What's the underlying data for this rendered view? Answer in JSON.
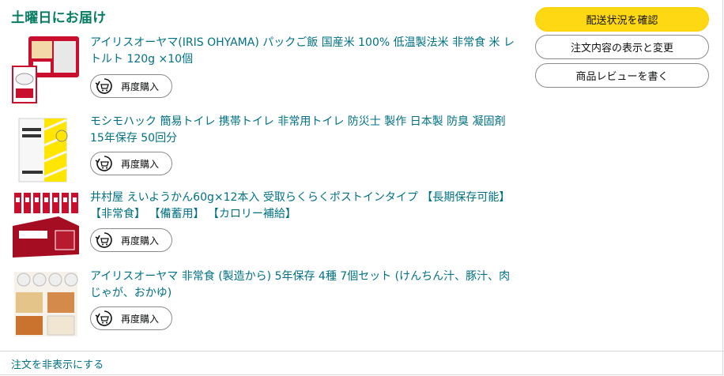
{
  "delivery": {
    "heading": "土曜日にお届け"
  },
  "items": [
    {
      "title": "アイリスオーヤマ(IRIS OHYAMA) パックご飯 国産米 100% 低温製法米 非常食 米 レトルト 120g ×10個",
      "rebuy_label": "再度購入",
      "thumb_icon": "rice-pack-product-image"
    },
    {
      "title": "モシモハック 簡易トイレ 携帯トイレ 非常用トイレ 防災士 製作 日本製 防臭 凝固剤 15年保存 50回分",
      "rebuy_label": "再度購入",
      "thumb_icon": "portable-toilet-product-image"
    },
    {
      "title": "井村屋 えいようかん60g×12本入 受取らくらくポストインタイプ 【長期保存可能】【非常食】 【備蓄用】 【カロリー補給】",
      "rebuy_label": "再度購入",
      "thumb_icon": "yokan-box-product-image"
    },
    {
      "title": "アイリスオーヤマ 非常食 (製造から) 5年保存 4種 7個セット (けんちん汁、豚汁、肉じゃが、おかゆ)",
      "rebuy_label": "再度購入",
      "thumb_icon": "emergency-food-set-product-image"
    }
  ],
  "actions": {
    "track": "配送状況を確認",
    "edit": "注文内容の表示と変更",
    "review": "商品レビューを書く"
  },
  "footer": {
    "hide_order": "注文を非表示にする"
  },
  "colors": {
    "heading": "#067d62",
    "link": "#007185",
    "primary_button": "#ffd814"
  }
}
